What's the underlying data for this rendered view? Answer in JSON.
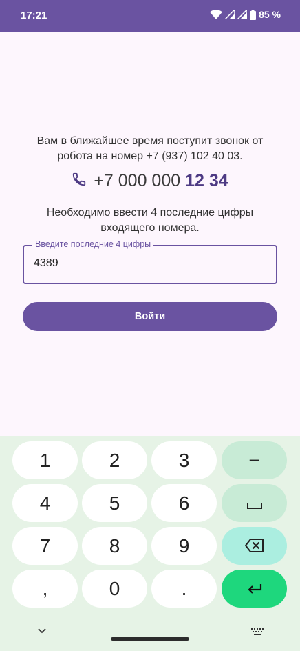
{
  "status": {
    "time": "17:21",
    "battery": "85 %"
  },
  "message": {
    "line1": "Вам в ближайшее время поступит звонок от",
    "line2": "робота на номер +7 (937) 102 40 03."
  },
  "phone": {
    "prefix": "+7 000 000 ",
    "highlight": "12 34"
  },
  "instruction": {
    "line1": "Необходимо ввести 4 последние цифры",
    "line2": "входящего номера."
  },
  "code_field": {
    "label": "Введите последние 4 цифры",
    "value": "4389"
  },
  "login_button": "Войти",
  "keyboard": {
    "row1": [
      "1",
      "2",
      "3",
      "−"
    ],
    "row2": [
      "4",
      "5",
      "6"
    ],
    "row3": [
      "7",
      "8",
      "9"
    ],
    "row4": [
      ",",
      "0",
      "."
    ]
  },
  "colors": {
    "accent": "#6a53a1",
    "highlight": "#4e3b84",
    "enter_key": "#1ed77d",
    "keyboard_bg": "#e6f3e6"
  },
  "icons": {
    "phone": "phone-icon",
    "wifi": "wifi-icon",
    "signal": "signal-icon",
    "battery": "battery-icon",
    "space": "space-icon",
    "backspace": "backspace-icon",
    "enter": "enter-icon",
    "hide_keyboard": "chevron-down-icon",
    "keyboard_switch": "keyboard-icon"
  }
}
